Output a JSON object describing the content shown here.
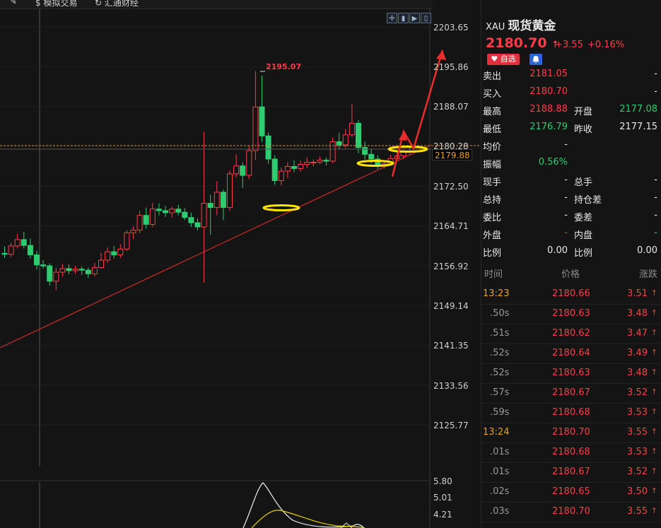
{
  "topbar": {
    "items": [
      "模拟交易",
      "汇通财经"
    ]
  },
  "toolbar": {
    "icons": [
      "crosshair-icon",
      "bar-chart-icon",
      "play-icon",
      "bar-mode-icon"
    ]
  },
  "chart": {
    "y_axis_labels": [
      "2203.65",
      "2195.86",
      "2188.07",
      "2180.28",
      "2172.50",
      "2164.71",
      "2156.92",
      "2149.14",
      "2141.35",
      "2133.56",
      "2125.77"
    ],
    "current_price_tag": "2179.88",
    "high_label": "2195.07",
    "indicator_labels": [
      "5.80",
      "5.01",
      "4.21"
    ],
    "colors": {
      "up": "#ff3b4a",
      "down": "#2ecc71",
      "trend": "#d42a2a",
      "highlight": "#ffe400"
    }
  },
  "chart_data": {
    "type": "candlestick",
    "ylim": [
      2120,
      2207
    ],
    "candles": [
      [
        2160.5,
        2160.3,
        2161.8,
        2159.6
      ],
      [
        2160.3,
        2161.9,
        2162.5,
        2159.8
      ],
      [
        2161.9,
        2163.1,
        2164.2,
        2161.5
      ],
      [
        2163.1,
        2162.0,
        2164.6,
        2161.4
      ],
      [
        2162.0,
        2160.2,
        2163.3,
        2159.5
      ],
      [
        2160.2,
        2158.3,
        2161.0,
        2157.4
      ],
      [
        2158.3,
        2158.1,
        2159.2,
        2157.6
      ],
      [
        2158.1,
        2155.2,
        2158.6,
        2154.4
      ],
      [
        2155.2,
        2156.9,
        2157.8,
        2153.5
      ],
      [
        2156.9,
        2157.6,
        2158.5,
        2156.1
      ],
      [
        2157.6,
        2157.2,
        2158.4,
        2156.5
      ],
      [
        2157.2,
        2157.5,
        2158.1,
        2156.6
      ],
      [
        2157.5,
        2157.3,
        2158.0,
        2156.4
      ],
      [
        2157.3,
        2156.6,
        2157.8,
        2155.8
      ],
      [
        2156.6,
        2157.8,
        2158.7,
        2156.1
      ],
      [
        2157.8,
        2159.2,
        2160.6,
        2157.6
      ],
      [
        2159.2,
        2160.8,
        2161.6,
        2158.7
      ],
      [
        2160.8,
        2160.2,
        2161.9,
        2159.5
      ],
      [
        2160.2,
        2161.3,
        2162.2,
        2159.6
      ],
      [
        2161.3,
        2164.4,
        2164.9,
        2160.9
      ],
      [
        2164.4,
        2164.9,
        2165.6,
        2163.2
      ],
      [
        2164.9,
        2167.7,
        2168.6,
        2164.3
      ],
      [
        2167.7,
        2166.0,
        2169.2,
        2165.2
      ],
      [
        2166.0,
        2168.9,
        2170.1,
        2165.5
      ],
      [
        2168.9,
        2168.6,
        2170.0,
        2167.7
      ],
      [
        2168.6,
        2168.2,
        2169.5,
        2167.4
      ],
      [
        2168.2,
        2168.9,
        2169.4,
        2167.3
      ],
      [
        2168.9,
        2168.3,
        2169.7,
        2167.7
      ],
      [
        2168.3,
        2167.3,
        2169.1,
        2166.8
      ],
      [
        2167.3,
        2166.3,
        2168.2,
        2165.5
      ],
      [
        2166.3,
        2165.5,
        2167.1,
        2164.9
      ],
      [
        2165.5,
        2170.0,
        2183.6,
        2154.9
      ],
      [
        2170.0,
        2169.2,
        2171.6,
        2164.0
      ],
      [
        2169.2,
        2172.1,
        2174.2,
        2167.7
      ],
      [
        2172.1,
        2169.2,
        2172.6,
        2166.8
      ],
      [
        2169.2,
        2175.6,
        2176.2,
        2168.5
      ],
      [
        2175.6,
        2177.1,
        2179.3,
        2174.9
      ],
      [
        2177.1,
        2175.3,
        2177.8,
        2172.9
      ],
      [
        2175.3,
        2180.0,
        2181.0,
        2174.6
      ],
      [
        2180.0,
        2188.3,
        2195.1,
        2178.2
      ],
      [
        2188.3,
        2182.8,
        2194.3,
        2181.7
      ],
      [
        2182.8,
        2178.4,
        2183.5,
        2177.5
      ],
      [
        2178.4,
        2174.3,
        2179.1,
        2173.5
      ],
      [
        2174.3,
        2176.1,
        2176.8,
        2173.4
      ],
      [
        2176.1,
        2177.0,
        2177.8,
        2174.8
      ],
      [
        2177.0,
        2176.6,
        2178.2,
        2175.9
      ],
      [
        2176.6,
        2177.4,
        2178.1,
        2176.0
      ],
      [
        2177.4,
        2177.8,
        2178.7,
        2176.7
      ],
      [
        2177.8,
        2177.8,
        2178.3,
        2177.0
      ],
      [
        2177.8,
        2178.2,
        2178.9,
        2177.4
      ],
      [
        2178.2,
        2178.0,
        2178.7,
        2177.2
      ],
      [
        2178.0,
        2181.7,
        2182.5,
        2177.6
      ],
      [
        2181.7,
        2181.1,
        2183.4,
        2180.2
      ],
      [
        2181.1,
        2183.0,
        2184.1,
        2180.5
      ],
      [
        2183.0,
        2185.2,
        2188.9,
        2182.6
      ],
      [
        2185.2,
        2180.6,
        2185.8,
        2179.5
      ],
      [
        2180.6,
        2179.3,
        2181.7,
        2178.3
      ],
      [
        2179.3,
        2178.4,
        2180.2,
        2177.5
      ],
      [
        2178.4,
        2177.1,
        2179.1,
        2176.5
      ],
      [
        2177.1,
        2177.5,
        2178.2,
        2176.6
      ],
      [
        2177.5,
        2178.5,
        2179.2,
        2177.1
      ],
      [
        2178.5,
        2179.0,
        2179.8,
        2178.0
      ],
      [
        2179.0,
        2179.8,
        2180.4,
        2178.4
      ],
      [
        2179.8,
        2179.9,
        2180.7,
        2179.2
      ]
    ]
  },
  "quote": {
    "code": "XAU",
    "name": "现货黄金",
    "price": "2180.70",
    "change": "+3.55",
    "change_pct": "+0.16%",
    "fav_label": "自选",
    "rows": [
      {
        "l1": "卖出",
        "v1": "2181.05",
        "c1": "red",
        "l2": "",
        "v2": "-",
        "c2": "white"
      },
      {
        "l1": "买入",
        "v1": "2180.70",
        "c1": "red",
        "l2": "",
        "v2": "-",
        "c2": "white"
      },
      {
        "l1": "最高",
        "v1": "2188.88",
        "c1": "red",
        "l2": "开盘",
        "v2": "2177.08",
        "c2": "green"
      },
      {
        "l1": "最低",
        "v1": "2176.79",
        "c1": "green",
        "l2": "昨收",
        "v2": "2177.15",
        "c2": "white"
      },
      {
        "l1": "均价",
        "v1": "-",
        "c1": "white",
        "l2": "",
        "v2": "",
        "c2": "white"
      },
      {
        "l1": "振幅",
        "v1": "0.56%",
        "c1": "green",
        "l2": "",
        "v2": "",
        "c2": "white"
      },
      {
        "l1": "现手",
        "v1": "-",
        "c1": "white",
        "l2": "总手",
        "v2": "-",
        "c2": "white"
      },
      {
        "l1": "总持",
        "v1": "-",
        "c1": "white",
        "l2": "持仓差",
        "v2": "-",
        "c2": "white"
      },
      {
        "l1": "委比",
        "v1": "-",
        "c1": "white",
        "l2": "委差",
        "v2": "-",
        "c2": "white"
      },
      {
        "l1": "外盘",
        "v1": "-",
        "c1": "red",
        "l2": "内盘",
        "v2": "-",
        "c2": "green"
      },
      {
        "l1": "比例",
        "v1": "0.00",
        "c1": "white",
        "l2": "比例",
        "v2": "0.00",
        "c2": "white"
      }
    ]
  },
  "ticks_header": {
    "time": "时间",
    "price": "价格",
    "change": "涨跌"
  },
  "ticks": [
    {
      "time": "13:23",
      "price": "2180.66",
      "change": "3.51"
    },
    {
      "time": ".50s",
      "price": "2180.63",
      "change": "3.48"
    },
    {
      "time": ".51s",
      "price": "2180.62",
      "change": "3.47"
    },
    {
      "time": ".52s",
      "price": "2180.64",
      "change": "3.49"
    },
    {
      "time": ".52s",
      "price": "2180.63",
      "change": "3.48"
    },
    {
      "time": ".57s",
      "price": "2180.67",
      "change": "3.52"
    },
    {
      "time": ".59s",
      "price": "2180.68",
      "change": "3.53"
    },
    {
      "time": "13:24",
      "price": "2180.70",
      "change": "3.55"
    },
    {
      "time": ".01s",
      "price": "2180.68",
      "change": "3.53"
    },
    {
      "time": ".01s",
      "price": "2180.67",
      "change": "3.52"
    },
    {
      "time": ".02s",
      "price": "2180.65",
      "change": "3.50"
    },
    {
      "time": ".03s",
      "price": "2180.70",
      "change": "3.55"
    }
  ]
}
